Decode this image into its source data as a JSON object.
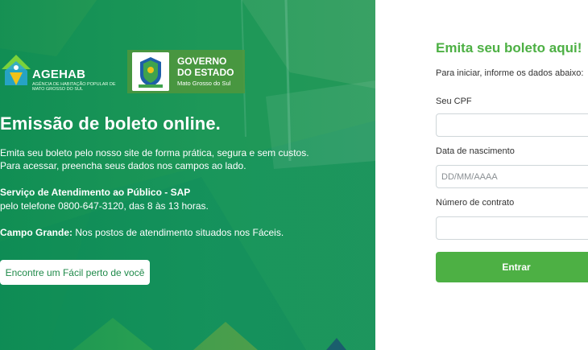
{
  "hero": {
    "agehab": {
      "name": "AGEHAB",
      "subtitle": "AGÊNCIA DE HABITAÇÃO POPULAR DE MATO GROSSO DO SUL"
    },
    "government": {
      "line1": "GOVERNO",
      "line2": "DO ESTADO",
      "line3": "Mato Grosso do Sul"
    },
    "title": "Emissão de boleto online.",
    "intro": "Emita seu boleto pelo nosso site de forma prática, segura e sem custos. Para acessar, preencha seus dados nos campos ao lado.",
    "sap_title": "Serviço de Atendimento ao Público - SAP",
    "sap_line": "pelo telefone 0800-647-3120, das 8 às 13 horas.",
    "cg_label": "Campo Grande:",
    "cg_text": " Nos postos de atendimento situados nos Fáceis.",
    "facil_button": "Encontre um Fácil perto de você"
  },
  "form": {
    "title": "Emita seu boleto aqui!",
    "hint": "Para iniciar, informe os dados abaixo:",
    "cpf_label": "Seu CPF",
    "cpf_value": "",
    "birth_label": "Data de nascimento",
    "birth_placeholder": "DD/MM/AAAA",
    "contract_label": "Número de contrato",
    "contract_value": "",
    "submit_label": "Entrar"
  },
  "colors": {
    "accent_green": "#4db044",
    "hero_green": "#1a9a5c"
  }
}
